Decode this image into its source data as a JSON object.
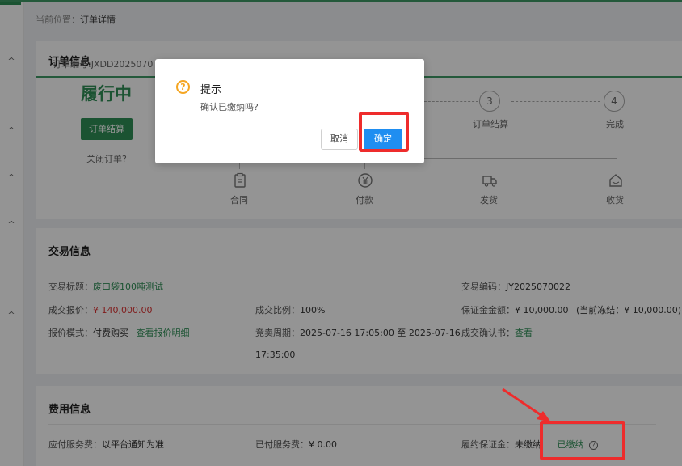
{
  "breadcrumb": {
    "prefix": "当前位置：",
    "current": "订单详情"
  },
  "order": {
    "title": "订单信息",
    "order_no": "订单编号:JXDD2025070",
    "status": "履行中",
    "settle_button": "订单结算",
    "close_link": "关闭订单?",
    "steps": [
      {
        "num": "3",
        "label": "订单结算"
      },
      {
        "num": "4",
        "label": "完成"
      }
    ],
    "flow": [
      {
        "label": "合同",
        "icon": "contract-icon"
      },
      {
        "label": "付款",
        "icon": "payment-icon"
      },
      {
        "label": "发货",
        "icon": "truck-icon"
      },
      {
        "label": "收货",
        "icon": "receive-icon"
      }
    ]
  },
  "trade": {
    "title": "交易信息",
    "subject_label": "交易标题：",
    "subject_value": "废口袋100吨测试",
    "code_label": "交易编码：",
    "code_value": "JY2025070022",
    "price_label": "成交报价：",
    "price_value": "¥ 140,000.00",
    "ratio_label": "成交比例：",
    "ratio_value": "100%",
    "deposit_label": "保证金金额：",
    "deposit_value": "¥ 10,000.00",
    "frozen_text": "(当前冻结：¥ 10,000.00)",
    "mode_label": "报价模式：",
    "mode_value": "付费购买",
    "mode_link": "查看报价明细",
    "period_label": "竞卖周期：",
    "period_value_line1": "2025-07-16 17:05:00 至 2025-07-16",
    "period_value_line2": "17:35:00",
    "confirm_label": "成交确认书：",
    "confirm_link": "查看"
  },
  "fee": {
    "title": "费用信息",
    "service_label": "应付服务费：",
    "service_value": "以平台通知为准",
    "paid_label": "已付服务费：",
    "paid_value": "¥ 0.00",
    "bond_label": "履约保证金：",
    "bond_unpaid": "未缴纳",
    "bond_paid": "已缴纳"
  },
  "dialog": {
    "title": "提示",
    "message": "确认已缴纳吗?",
    "cancel": "取消",
    "ok": "确定"
  },
  "colors": {
    "brand_green": "#2f8f57",
    "primary_blue": "#1f8ef1",
    "warning_orange": "#f5a623",
    "highlight_red": "#ee2c2c",
    "price_red": "#d33"
  }
}
